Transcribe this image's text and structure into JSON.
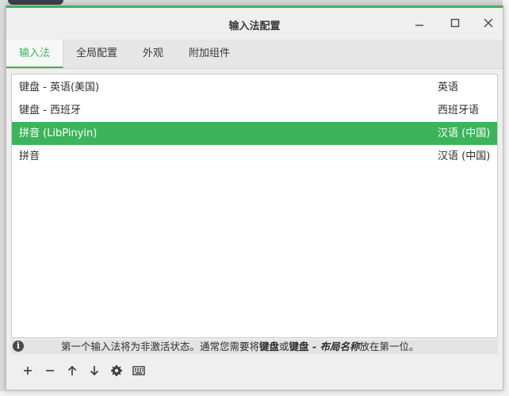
{
  "window": {
    "title": "输入法配置"
  },
  "tabs": [
    {
      "label": "输入法",
      "active": true
    },
    {
      "label": "全局配置",
      "active": false
    },
    {
      "label": "外观",
      "active": false
    },
    {
      "label": "附加组件",
      "active": false
    }
  ],
  "input_methods": [
    {
      "name": "键盘 - 英语(美国)",
      "language": "英语",
      "selected": false
    },
    {
      "name": "键盘 - 西班牙",
      "language": "西班牙语",
      "selected": false
    },
    {
      "name": "拼音 (LibPinyin)",
      "language": "汉语 (中国)",
      "selected": true
    },
    {
      "name": "拼音",
      "language": "汉语 (中国)",
      "selected": false
    }
  ],
  "info": {
    "part1": "第一个输入法将为非激活状态。通常您需要将",
    "part2": "键盘",
    "part3": "或",
    "part4": "键盘 - ",
    "part5": "布局名称",
    "part6": "放在第一位。"
  },
  "toolbar": {
    "icons": [
      "add-icon",
      "remove-icon",
      "move-up-icon",
      "move-down-icon",
      "settings-icon",
      "keyboard-icon"
    ]
  },
  "colors": {
    "accent": "#3cb55a",
    "selection": "#3cb55a"
  }
}
